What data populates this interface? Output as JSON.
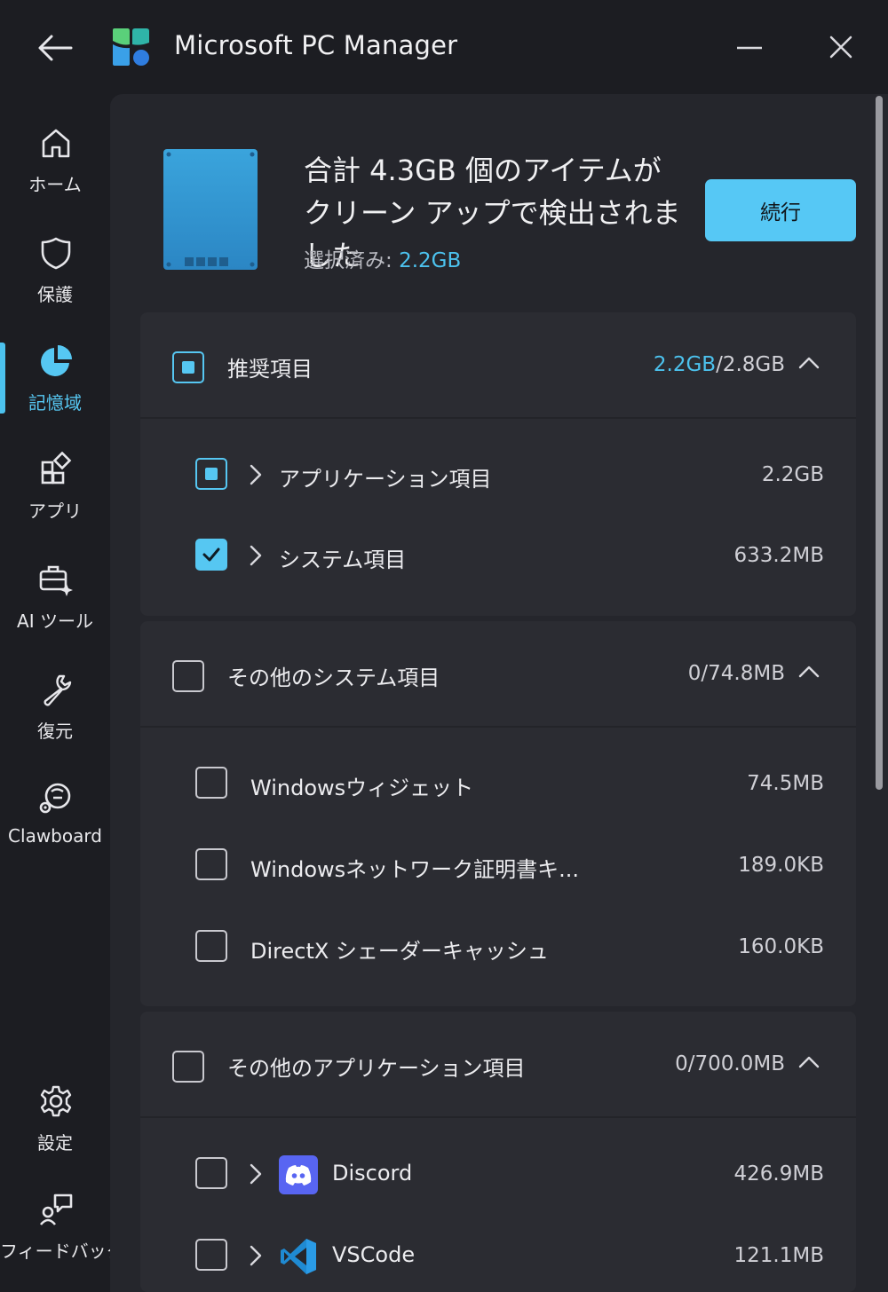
{
  "window": {
    "title": "Microsoft PC Manager"
  },
  "sidebar": {
    "items": [
      {
        "label": "ホーム",
        "icon": "home-icon"
      },
      {
        "label": "保護",
        "icon": "shield-icon"
      },
      {
        "label": "記憶域",
        "icon": "pie-chart-icon",
        "active": true
      },
      {
        "label": "アプリ",
        "icon": "apps-icon"
      },
      {
        "label": "AI ツール",
        "icon": "ai-toolbox-icon"
      },
      {
        "label": "復元",
        "icon": "wrench-icon"
      },
      {
        "label": "Clawboard",
        "icon": "clawboard-icon"
      },
      {
        "label": "設定",
        "icon": "gear-icon"
      },
      {
        "label": "フィードバック",
        "icon": "feedback-icon"
      }
    ]
  },
  "summary": {
    "headline": "合計 4.3GB 個のアイテムが クリーン アップで検出されました",
    "selected_label": "選択済み: ",
    "selected_value": "2.2GB",
    "continue_label": "続行"
  },
  "sections": [
    {
      "title": "推奨項目",
      "size_selected": "2.2GB",
      "size_total": "/2.8GB",
      "state": "partial",
      "items": [
        {
          "label": "アプリケーション項目",
          "size": "2.2GB",
          "state": "partial",
          "expandable": true
        },
        {
          "label": "システム項目",
          "size": "633.2MB",
          "state": "checked",
          "expandable": true
        }
      ]
    },
    {
      "title": "その他のシステム項目",
      "size": "0/74.8MB",
      "state": "unchecked",
      "items": [
        {
          "label": "Windowsウィジェット",
          "size": "74.5MB",
          "state": "unchecked"
        },
        {
          "label": "Windowsネットワーク証明書キ...",
          "size": "189.0KB",
          "state": "unchecked"
        },
        {
          "label": "DirectX シェーダーキャッシュ",
          "size": "160.0KB",
          "state": "unchecked"
        }
      ]
    },
    {
      "title": "その他のアプリケーション項目",
      "size": "0/700.0MB",
      "state": "unchecked",
      "items": [
        {
          "label": "Discord",
          "size": "426.9MB",
          "state": "unchecked",
          "expandable": true,
          "icon": "discord-icon"
        },
        {
          "label": "VSCode",
          "size": "121.1MB",
          "state": "unchecked",
          "expandable": true,
          "icon": "vscode-icon"
        }
      ]
    }
  ],
  "colors": {
    "accent": "#56c7f2",
    "background": "#1c1d22",
    "panel": "#25262c",
    "card": "#2b2c32"
  }
}
